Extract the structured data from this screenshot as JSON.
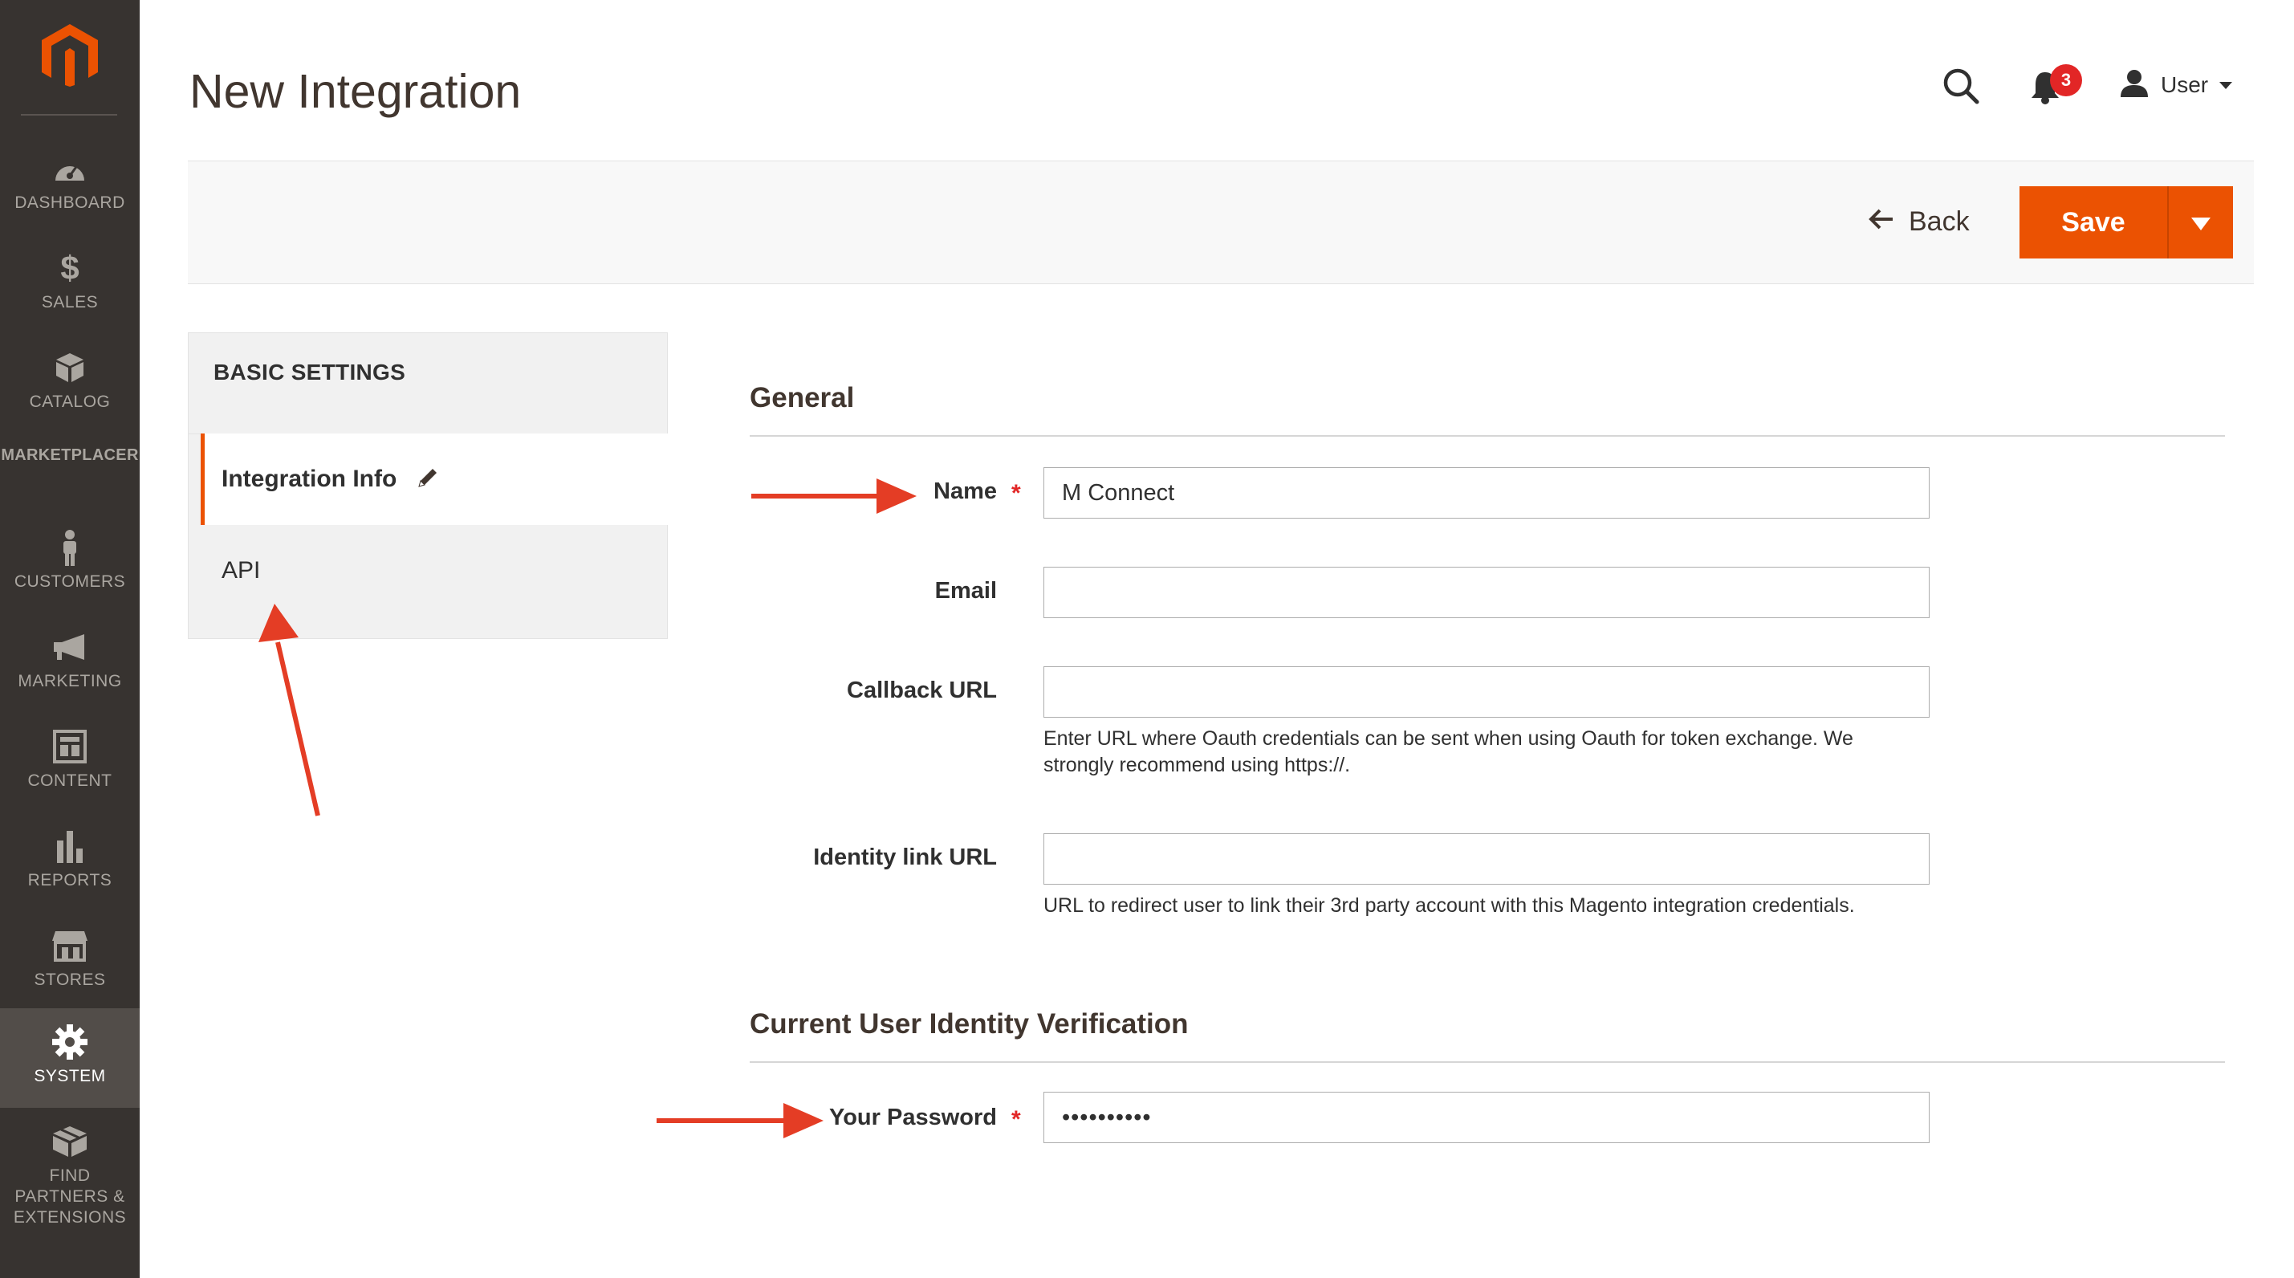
{
  "page": {
    "title": "New Integration"
  },
  "sidebar": {
    "logo": "magento-logo",
    "items": [
      {
        "label": "DASHBOARD",
        "icon": "dashboard-icon"
      },
      {
        "label": "SALES",
        "icon": "dollar-icon"
      },
      {
        "label": "CATALOG",
        "icon": "box-icon"
      },
      {
        "label": "MARKETPLACER",
        "icon": ""
      },
      {
        "label": "CUSTOMERS",
        "icon": "person-icon"
      },
      {
        "label": "MARKETING",
        "icon": "megaphone-icon"
      },
      {
        "label": "CONTENT",
        "icon": "content-icon"
      },
      {
        "label": "REPORTS",
        "icon": "bar-chart-icon"
      },
      {
        "label": "STORES",
        "icon": "store-icon"
      },
      {
        "label": "SYSTEM",
        "icon": "gear-icon"
      },
      {
        "label": "FIND PARTNERS & EXTENSIONS",
        "icon": "boxes-icon"
      }
    ],
    "active": "SYSTEM"
  },
  "header": {
    "notifications_count": "3",
    "user_name": "User"
  },
  "actions": {
    "back_label": "Back",
    "save_label": "Save"
  },
  "tabs": {
    "heading": "BASIC SETTINGS",
    "items": [
      {
        "label": "Integration Info",
        "active": true
      },
      {
        "label": "API",
        "active": false
      }
    ]
  },
  "form": {
    "general_title": "General",
    "name": {
      "label": "Name",
      "value": "M Connect",
      "required": true
    },
    "email": {
      "label": "Email",
      "value": ""
    },
    "callback": {
      "label": "Callback URL",
      "value": "",
      "note_line1": "Enter URL where Oauth credentials can be sent when using Oauth for token exchange. We",
      "note_line2": "strongly recommend using https://."
    },
    "identity": {
      "label": "Identity link URL",
      "value": "",
      "note": "URL to redirect user to link their 3rd party account with this Magento integration credentials."
    },
    "verify_title": "Current User Identity Verification",
    "password": {
      "label": "Your Password",
      "value": "••••••••••",
      "required": true
    }
  },
  "colors": {
    "sidebar_bg": "#373330",
    "accent": "#eb5202",
    "required": "#e22626",
    "annotation_arrow": "#e43d25"
  }
}
